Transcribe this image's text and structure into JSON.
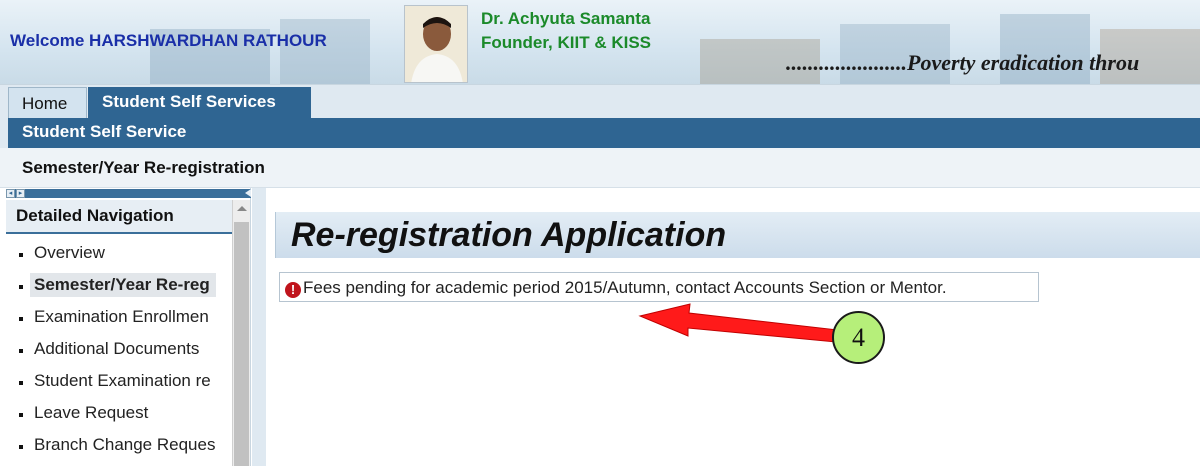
{
  "header": {
    "welcome_text": "Welcome HARSHWARDHAN RATHOUR",
    "founder_name": "Dr. Achyuta Samanta",
    "founder_title": "Founder, KIIT & KISS",
    "motto": "......................Poverty eradication throu"
  },
  "topnav": {
    "home_label": "Home",
    "student_self_services_label": "Student Self Services"
  },
  "subnav": {
    "student_self_service_label": "Student Self Service"
  },
  "page": {
    "breadcrumb": "Semester/Year Re-registration"
  },
  "sidebar": {
    "header": "Detailed Navigation",
    "items": [
      {
        "label": "Overview",
        "active": false
      },
      {
        "label": "Semester/Year Re-reg",
        "active": true
      },
      {
        "label": "Examination Enrollmen",
        "active": false
      },
      {
        "label": "Additional Documents",
        "active": false
      },
      {
        "label": "Student Examination re",
        "active": false
      },
      {
        "label": "Leave Request",
        "active": false
      },
      {
        "label": "Branch Change Reques",
        "active": false
      }
    ]
  },
  "main": {
    "title": "Re-registration Application",
    "message": "Fees pending for academic period 2015/Autumn, contact Accounts Section or Mentor.",
    "message_icon": "error-icon"
  },
  "annotation": {
    "callout_number": "4",
    "arrow_color": "#ff1a1a",
    "callout_color": "#b6ef7a"
  },
  "colors": {
    "primary_blue": "#2f6592",
    "founder_green": "#1b8a2a",
    "welcome_blue": "#1a2fa8",
    "error_red": "#c0141c"
  }
}
